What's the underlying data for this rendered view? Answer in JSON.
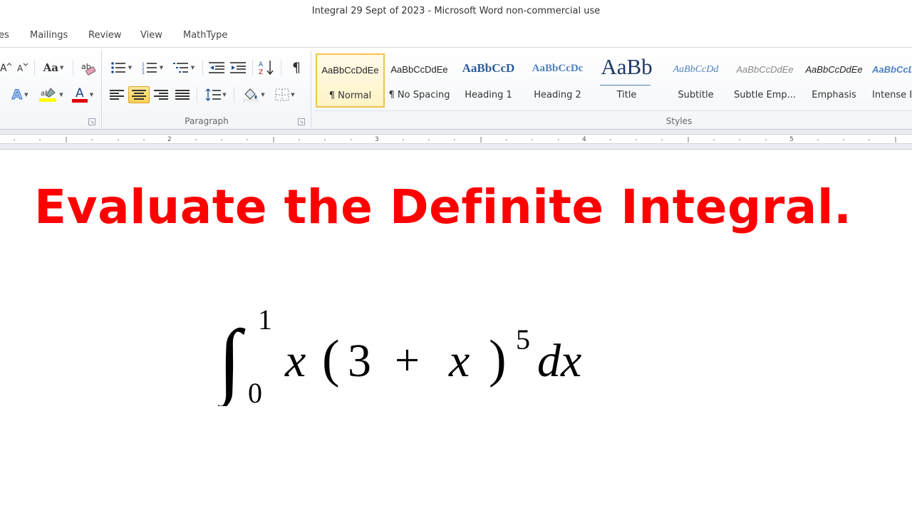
{
  "window": {
    "title": "Integral 29 Sept of 2023  -  Microsoft Word non-commercial use"
  },
  "tabs": [
    {
      "label": "es"
    },
    {
      "label": "Mailings"
    },
    {
      "label": "Review"
    },
    {
      "label": "View"
    },
    {
      "label": "MathType"
    }
  ],
  "ribbon": {
    "font_group": {
      "change_case_label": "Aa",
      "font_color_label": "A",
      "text_effects_label": "A"
    },
    "paragraph_group": {
      "label": "Paragraph",
      "show_marks_label": "¶"
    },
    "styles_group": {
      "label": "Styles",
      "styles": [
        {
          "sample": "AaBbCcDdEe",
          "name": "¶ Normal",
          "selected": true
        },
        {
          "sample": "AaBbCcDdEe",
          "name": "¶ No Spacing",
          "selected": false
        },
        {
          "sample": "AaBbCcD",
          "name": "Heading 1",
          "selected": false
        },
        {
          "sample": "AaBbCcDc",
          "name": "Heading 2",
          "selected": false
        },
        {
          "sample": "AaBb",
          "name": "Title",
          "selected": false
        },
        {
          "sample": "AaBbCcDd",
          "name": "Subtitle",
          "selected": false
        },
        {
          "sample": "AaBbCcDdEe",
          "name": "Subtle Emp...",
          "selected": false
        },
        {
          "sample": "AaBbCcDdEe",
          "name": "Emphasis",
          "selected": false
        },
        {
          "sample": "AaBbCcDd",
          "name": "Intense E",
          "selected": false
        }
      ]
    }
  },
  "ruler": {
    "numbers": [
      "2",
      "3",
      "4",
      "5"
    ]
  },
  "document": {
    "heading": "Evaluate the Definite Integral.",
    "equation": {
      "integral_sign": "∫",
      "upper_limit": "1",
      "lower_limit": "0",
      "variable": "x",
      "open_paren": "(",
      "constant": "3",
      "operator": "+",
      "inner_variable": "x",
      "close_paren": ")",
      "exponent": "5",
      "differential": "dx"
    }
  },
  "colors": {
    "heading": "#ff0000",
    "selected_style_border": "#f0c34a",
    "heading1_style": "#2f5b9a",
    "active_button": "#f7cf56"
  }
}
